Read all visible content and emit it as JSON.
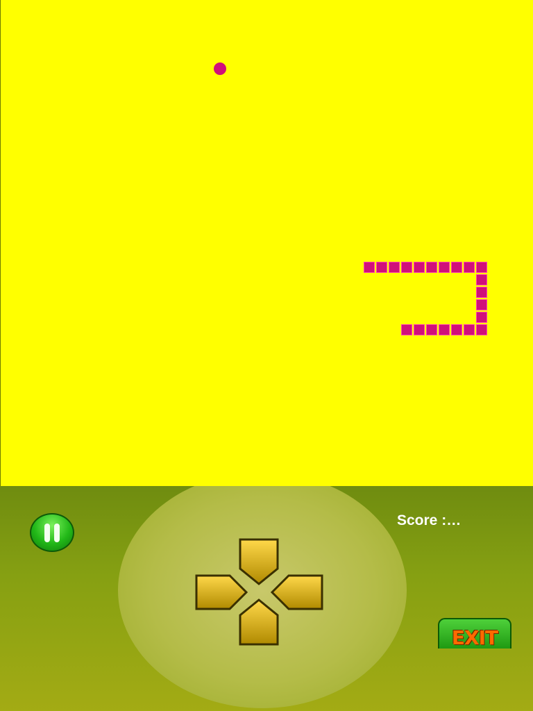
{
  "board": {
    "background": "#ffff00",
    "snake_color": "#d0107a"
  },
  "snake": {
    "cells": [
      [
        29,
        21
      ],
      [
        30,
        21
      ],
      [
        31,
        21
      ],
      [
        32,
        21
      ],
      [
        33,
        21
      ],
      [
        34,
        21
      ],
      [
        35,
        21
      ],
      [
        36,
        21
      ],
      [
        37,
        21
      ],
      [
        38,
        21
      ],
      [
        38,
        22
      ],
      [
        38,
        23
      ],
      [
        38,
        24
      ],
      [
        38,
        25
      ],
      [
        38,
        26
      ],
      [
        37,
        26
      ],
      [
        36,
        26
      ],
      [
        35,
        26
      ],
      [
        34,
        26
      ],
      [
        33,
        26
      ],
      [
        32,
        26
      ]
    ]
  },
  "controls": {
    "score_label": "Score :…",
    "exit_label": "EXIT"
  }
}
